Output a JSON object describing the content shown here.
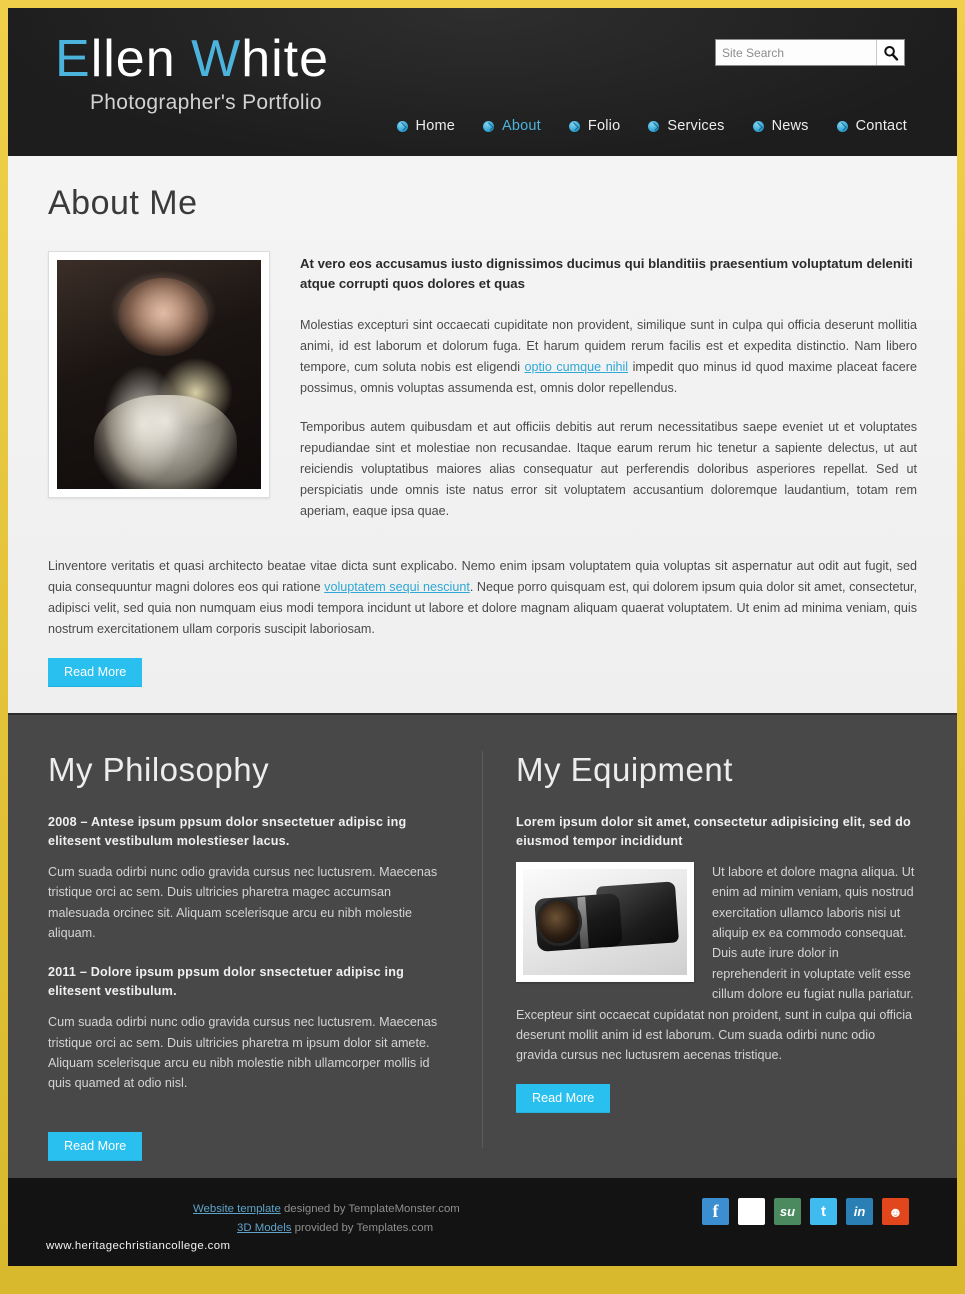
{
  "header": {
    "logo_accent_1": "E",
    "logo_rest_1": "llen",
    "logo_accent_2": "W",
    "logo_rest_2": "hite",
    "tagline": "Photographer's Portfolio",
    "search": {
      "placeholder": "Site Search",
      "value": "",
      "button_icon": "search-icon"
    },
    "nav": [
      {
        "label": "Home",
        "active": false
      },
      {
        "label": "About",
        "active": true
      },
      {
        "label": "Folio",
        "active": false
      },
      {
        "label": "Services",
        "active": false
      },
      {
        "label": "News",
        "active": false
      },
      {
        "label": "Contact",
        "active": false
      }
    ]
  },
  "about": {
    "title": "About Me",
    "photo_alt": "portrait-photo",
    "lead": "At vero eos accusamus iusto dignissimos ducimus qui blanditiis praesentium voluptatum deleniti atque corrupti quos dolores et quas",
    "para1_before": "Molestias excepturi sint occaecati cupiditate non provident, similique sunt in culpa qui officia deserunt mollitia animi, id est laborum et dolorum fuga. Et harum quidem rerum facilis est et expedita distinctio. Nam libero tempore, cum soluta nobis est eligendi ",
    "para1_link": "optio cumque nihil",
    "para1_after": " impedit quo minus id quod maxime placeat facere possimus, omnis voluptas assumenda est, omnis dolor repellendus.",
    "para2": "Temporibus autem quibusdam et aut officiis debitis aut rerum necessitatibus saepe eveniet ut et voluptates repudiandae sint et molestiae non recusandae. Itaque earum rerum hic tenetur a sapiente delectus, ut aut reiciendis voluptatibus maiores alias consequatur aut perferendis doloribus asperiores repellat. Sed ut perspiciatis unde omnis iste natus error sit voluptatem accusantium doloremque laudantium, totam rem aperiam, eaque ipsa quae.",
    "para3_before": "Linventore veritatis et quasi architecto beatae vitae dicta sunt explicabo. Nemo enim ipsam voluptatem quia voluptas sit aspernatur aut odit aut fugit, sed quia consequuntur magni dolores eos qui ratione ",
    "para3_link": "voluptatem sequi nesciunt",
    "para3_after": ". Neque porro quisquam est, qui dolorem ipsum quia dolor sit amet, consectetur, adipisci velit, sed quia non numquam eius modi tempora incidunt ut labore et dolore magnam aliquam quaerat voluptatem. Ut enim ad minima veniam, quis nostrum exercitationem ullam corporis suscipit laboriosam.",
    "read_more": "Read More"
  },
  "philosophy": {
    "title": "My Philosophy",
    "entries": [
      {
        "heading": "2008 – Antese ipsum ppsum dolor snsectetuer adipisc ing elitesent vestibulum molestieser lacus.",
        "body": "Cum suada odirbi nunc odio gravida cursus nec luctusrem. Maecenas tristique orci ac sem. Duis ultricies pharetra magec accumsan malesuada orcinec sit. Aliquam scelerisque arcu eu nibh molestie aliquam."
      },
      {
        "heading": "2011 – Dolore ipsum ppsum dolor snsectetuer adipisc ing elitesent vestibulum.",
        "body": "Cum suada odirbi nunc odio gravida cursus nec luctusrem. Maecenas tristique orci ac sem. Duis ultricies pharetra m ipsum dolor sit amete. Aliquam scelerisque arcu eu nibh molestie  nibh ullamcorper mollis id quis quamed at odio nisl."
      }
    ],
    "read_more": "Read More"
  },
  "equipment": {
    "title": "My Equipment",
    "lead": "Lorem ipsum dolor sit amet, consectetur adipisicing elit, sed do eiusmod tempor incididunt",
    "photo_alt": "camera-photo",
    "body": "Ut labore et dolore magna aliqua. Ut enim ad minim veniam, quis nostrud exercitation ullamco laboris nisi ut aliquip ex ea commodo consequat. Duis aute irure dolor in reprehenderit in voluptate velit esse cillum dolore eu fugiat nulla pariatur. Excepteur sint occaecat cupidatat non proident, sunt in culpa qui officia deserunt mollit anim id est laborum. Cum suada odirbi nunc odio gravida cursus nec luctusrem aecenas tristique.",
    "read_more": "Read More"
  },
  "footer": {
    "credit1_link": "Website template",
    "credit1_text": " designed by TemplateMonster.com",
    "credit2_link": "3D Models",
    "credit2_text": " provided by Templates.com",
    "site_url": "www.heritagechristiancollege.com",
    "socials": [
      {
        "name": "facebook-icon",
        "glyph": "f"
      },
      {
        "name": "delicious-icon",
        "glyph": ""
      },
      {
        "name": "stumbleupon-icon",
        "glyph": "su"
      },
      {
        "name": "twitter-icon",
        "glyph": "t"
      },
      {
        "name": "linkedin-icon",
        "glyph": "in"
      },
      {
        "name": "reddit-icon",
        "glyph": "☻"
      }
    ]
  },
  "colors": {
    "frame": "#e8c53a",
    "accent_cyan": "#29c0f0",
    "logo_accent": "#4cb3dd",
    "dark_panel": "#484848",
    "footer_bg": "#131313"
  }
}
